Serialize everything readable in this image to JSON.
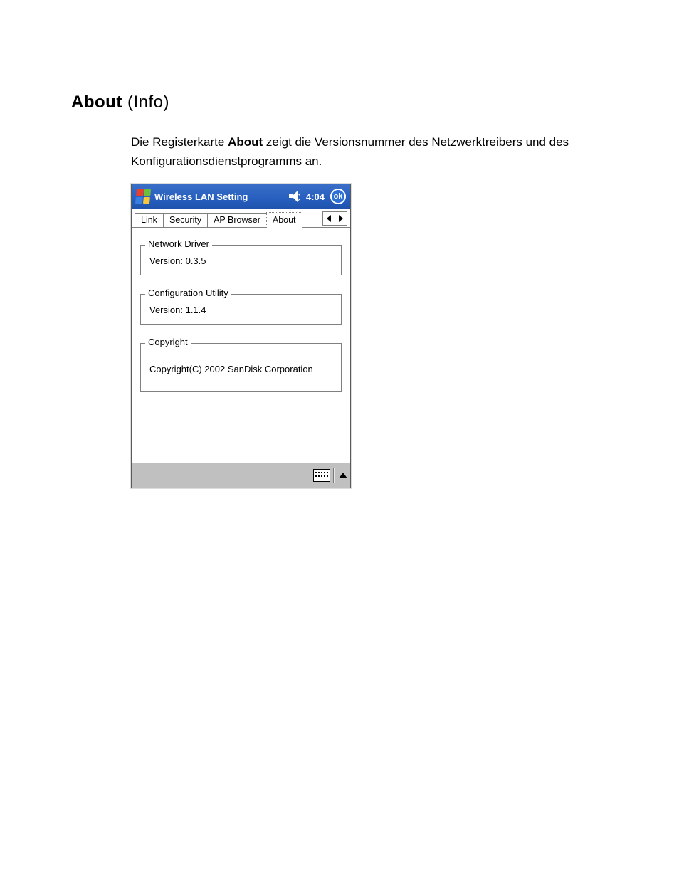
{
  "heading": {
    "bold": "About",
    "suffix": " (Info)"
  },
  "paragraph": {
    "pre": "Die Registerkarte ",
    "bold": "About",
    "post": " zeigt die Versionsnummer des Netzwerktreibers und des Konfigurationsdienstprogramms an."
  },
  "titlebar": {
    "appTitle": "Wireless LAN Setting",
    "time": "4:04",
    "ok": "ok"
  },
  "tabs": {
    "link": "Link",
    "security": "Security",
    "apBrowser": "AP Browser",
    "about": "About"
  },
  "groups": {
    "networkDriver": {
      "legend": "Network Driver",
      "line": "Version: 0.3.5"
    },
    "configUtility": {
      "legend": "Configuration Utility",
      "line": "Version: 1.1.4"
    },
    "copyright": {
      "legend": "Copyright",
      "line": "Copyright(C) 2002 SanDisk Corporation"
    }
  }
}
